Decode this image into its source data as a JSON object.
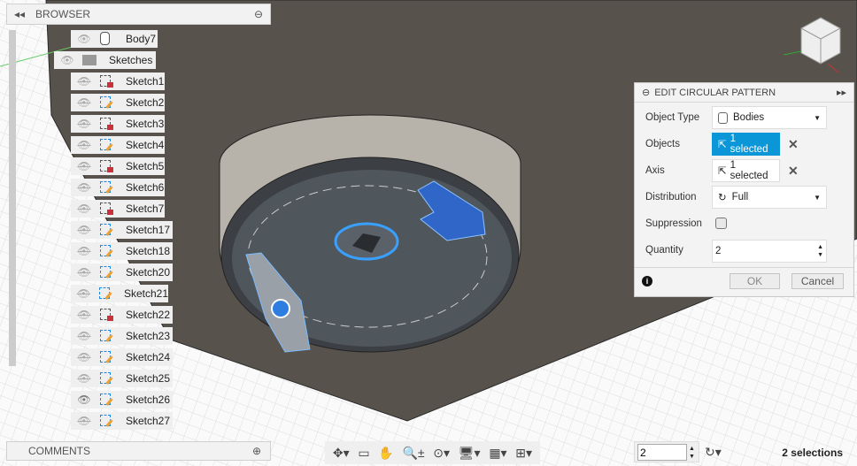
{
  "browser": {
    "title": "BROWSER",
    "items": [
      {
        "label": "Body7",
        "type": "body",
        "visible": true
      },
      {
        "label": "Sketches",
        "type": "folder",
        "visible": true
      }
    ],
    "sketches": [
      {
        "label": "Sketch1",
        "locked": true,
        "visible": false
      },
      {
        "label": "Sketch2",
        "locked": false,
        "visible": false
      },
      {
        "label": "Sketch3",
        "locked": true,
        "visible": false
      },
      {
        "label": "Sketch4",
        "locked": false,
        "visible": false
      },
      {
        "label": "Sketch5",
        "locked": true,
        "visible": false
      },
      {
        "label": "Sketch6",
        "locked": false,
        "visible": false
      },
      {
        "label": "Sketch7",
        "locked": true,
        "visible": false
      },
      {
        "label": "Sketch17",
        "locked": false,
        "visible": false
      },
      {
        "label": "Sketch18",
        "locked": false,
        "visible": false
      },
      {
        "label": "Sketch20",
        "locked": false,
        "visible": false
      },
      {
        "label": "Sketch21",
        "locked": false,
        "visible": false
      },
      {
        "label": "Sketch22",
        "locked": true,
        "visible": false
      },
      {
        "label": "Sketch23",
        "locked": false,
        "visible": false
      },
      {
        "label": "Sketch24",
        "locked": false,
        "visible": false
      },
      {
        "label": "Sketch25",
        "locked": false,
        "visible": false
      },
      {
        "label": "Sketch26",
        "locked": false,
        "visible": true
      },
      {
        "label": "Sketch27",
        "locked": false,
        "visible": false
      }
    ]
  },
  "comments": {
    "title": "COMMENTS"
  },
  "dialog": {
    "title": "EDIT CIRCULAR PATTERN",
    "object_type_label": "Object Type",
    "object_type": "Bodies",
    "objects_label": "Objects",
    "objects_value": "1 selected",
    "axis_label": "Axis",
    "axis_value": "1 selected",
    "distribution_label": "Distribution",
    "distribution": "Full",
    "suppression_label": "Suppression",
    "suppression": false,
    "quantity_label": "Quantity",
    "quantity": "2",
    "ok": "OK",
    "cancel": "Cancel"
  },
  "bottom": {
    "quantity_value": "2",
    "status": "2 selections"
  },
  "colors": {
    "accent": "#0b96d8",
    "selected_body": "#2f66c8"
  }
}
